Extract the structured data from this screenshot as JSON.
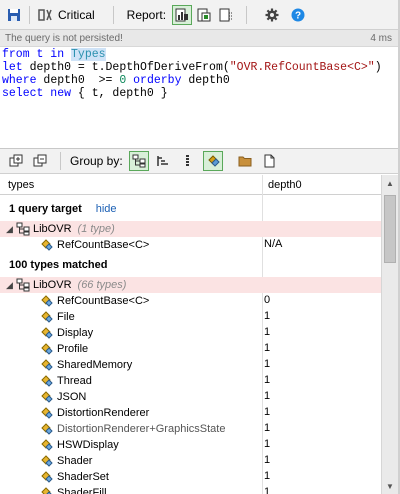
{
  "toolbar": {
    "critical_label": "Critical",
    "report_label": "Report:"
  },
  "status": {
    "message": "The query is not persisted!",
    "time": "4 ms"
  },
  "query": {
    "line1": [
      "from t in ",
      "Types"
    ],
    "line2": [
      "let depth0 = t.DepthOfDeriveFrom(",
      "\"OVR.RefCountBase<C>\"",
      ")"
    ],
    "line3": [
      "where",
      " depth0  >= ",
      "0",
      " orderby depth0"
    ],
    "line4": [
      "select new",
      " { t, depth0 }"
    ]
  },
  "bar2": {
    "group_by_label": "Group by:"
  },
  "grid": {
    "col_types": "types",
    "col_depth": "depth0",
    "targets_header": "1 query target",
    "hide_link": "hide",
    "target_group": {
      "name": "LibOVR",
      "count": "(1 type)"
    },
    "target_row": {
      "name": "RefCountBase<C>",
      "value": "N/A"
    },
    "matched_header": "100 types matched",
    "matched_group": {
      "name": "LibOVR",
      "count": "(66 types)"
    },
    "rows": [
      {
        "name": "RefCountBase<C>",
        "value": "0",
        "dim": false
      },
      {
        "name": "File",
        "value": "1",
        "dim": false
      },
      {
        "name": "Display",
        "value": "1",
        "dim": false
      },
      {
        "name": "Profile",
        "value": "1",
        "dim": false
      },
      {
        "name": "SharedMemory",
        "value": "1",
        "dim": false
      },
      {
        "name": "Thread",
        "value": "1",
        "dim": false
      },
      {
        "name": "JSON",
        "value": "1",
        "dim": false
      },
      {
        "name": "DistortionRenderer",
        "value": "1",
        "dim": false
      },
      {
        "name": "DistortionRenderer+GraphicsState",
        "value": "1",
        "dim": true
      },
      {
        "name": "HSWDisplay",
        "value": "1",
        "dim": false
      },
      {
        "name": "Shader",
        "value": "1",
        "dim": false
      },
      {
        "name": "ShaderSet",
        "value": "1",
        "dim": false
      },
      {
        "name": "ShaderFill",
        "value": "1",
        "dim": false
      }
    ]
  },
  "colors": {
    "pink_row": "#fbe3e3",
    "link": "#1a5fb4",
    "keyword": "#0000ff",
    "string": "#a31515"
  }
}
